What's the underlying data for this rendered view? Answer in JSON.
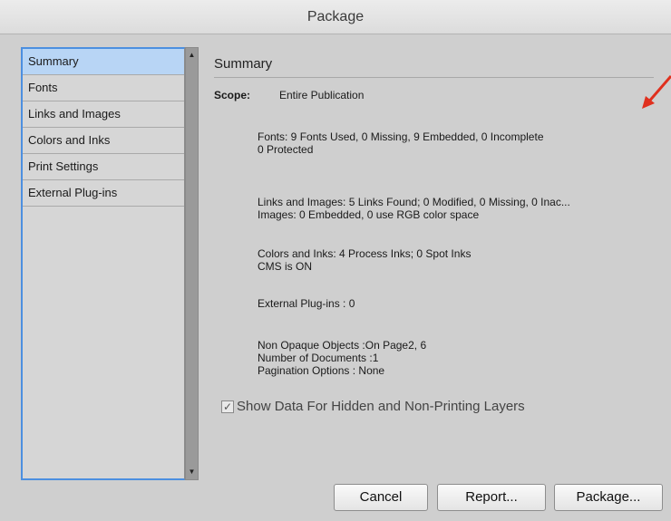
{
  "window": {
    "title": "Package"
  },
  "sidebar": {
    "items": [
      {
        "label": "Summary"
      },
      {
        "label": "Fonts"
      },
      {
        "label": "Links and Images"
      },
      {
        "label": "Colors and Inks"
      },
      {
        "label": "Print Settings"
      },
      {
        "label": "External Plug-ins"
      }
    ],
    "selected": "Summary"
  },
  "main": {
    "title": "Summary",
    "scope_label": "Scope:",
    "scope_value": "Entire Publication",
    "sections": [
      {
        "lines": [
          "Fonts: 9 Fonts Used, 0 Missing, 9 Embedded, 0 Incomplete",
          "0 Protected"
        ]
      },
      {
        "lines": [
          "Links and Images: 5 Links Found; 0 Modified, 0 Missing, 0 Inac...",
          "Images: 0 Embedded, 0 use RGB color space"
        ]
      },
      {
        "lines": [
          "Colors and Inks: 4 Process Inks; 0 Spot Inks",
          "CMS is ON"
        ]
      },
      {
        "lines": [
          "External Plug-ins : 0"
        ]
      },
      {
        "lines": [
          "Non Opaque Objects :On Page2, 6",
          "Number of Documents :1",
          "Pagination Options : None"
        ]
      }
    ],
    "checkbox": {
      "label": "Show Data For Hidden and Non-Printing Layers",
      "checked": true
    }
  },
  "buttons": {
    "cancel": "Cancel",
    "report": "Report...",
    "package": "Package..."
  },
  "colors": {
    "selection": "#b8d5f5",
    "focus_ring": "#4c8fe0",
    "annotation_arrow": "#e0301e"
  }
}
